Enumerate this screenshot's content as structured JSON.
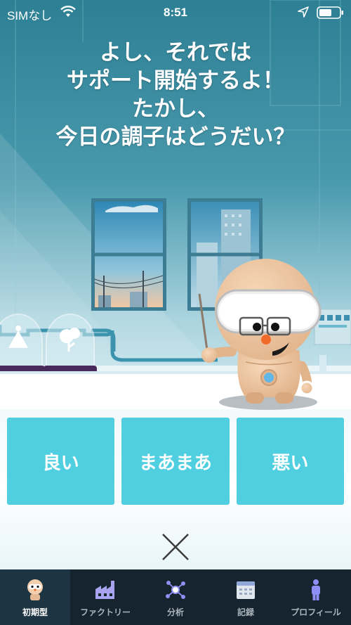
{
  "status_bar": {
    "carrier": "SIMなし",
    "time": "8:51"
  },
  "headline": {
    "lines": [
      "よし、それでは",
      "サポート開始するよ！",
      "たかし、",
      "今日の調子はどうだい？"
    ]
  },
  "mood_options": [
    {
      "label": "良い"
    },
    {
      "label": "まあまあ"
    },
    {
      "label": "悪い"
    }
  ],
  "tabs": [
    {
      "label": "初期型",
      "icon": "robot-avatar-icon",
      "active": true
    },
    {
      "label": "ファクトリー",
      "icon": "factory-icon",
      "active": false
    },
    {
      "label": "分析",
      "icon": "network-icon",
      "active": false
    },
    {
      "label": "記録",
      "icon": "calendar-icon",
      "active": false
    },
    {
      "label": "プロフィール",
      "icon": "person-icon",
      "active": false
    }
  ],
  "colors": {
    "accent": "#4fcfe0",
    "tab_bar": "#15242f",
    "tab_active": "#1d3442",
    "scene_top": "#2d7f93"
  }
}
